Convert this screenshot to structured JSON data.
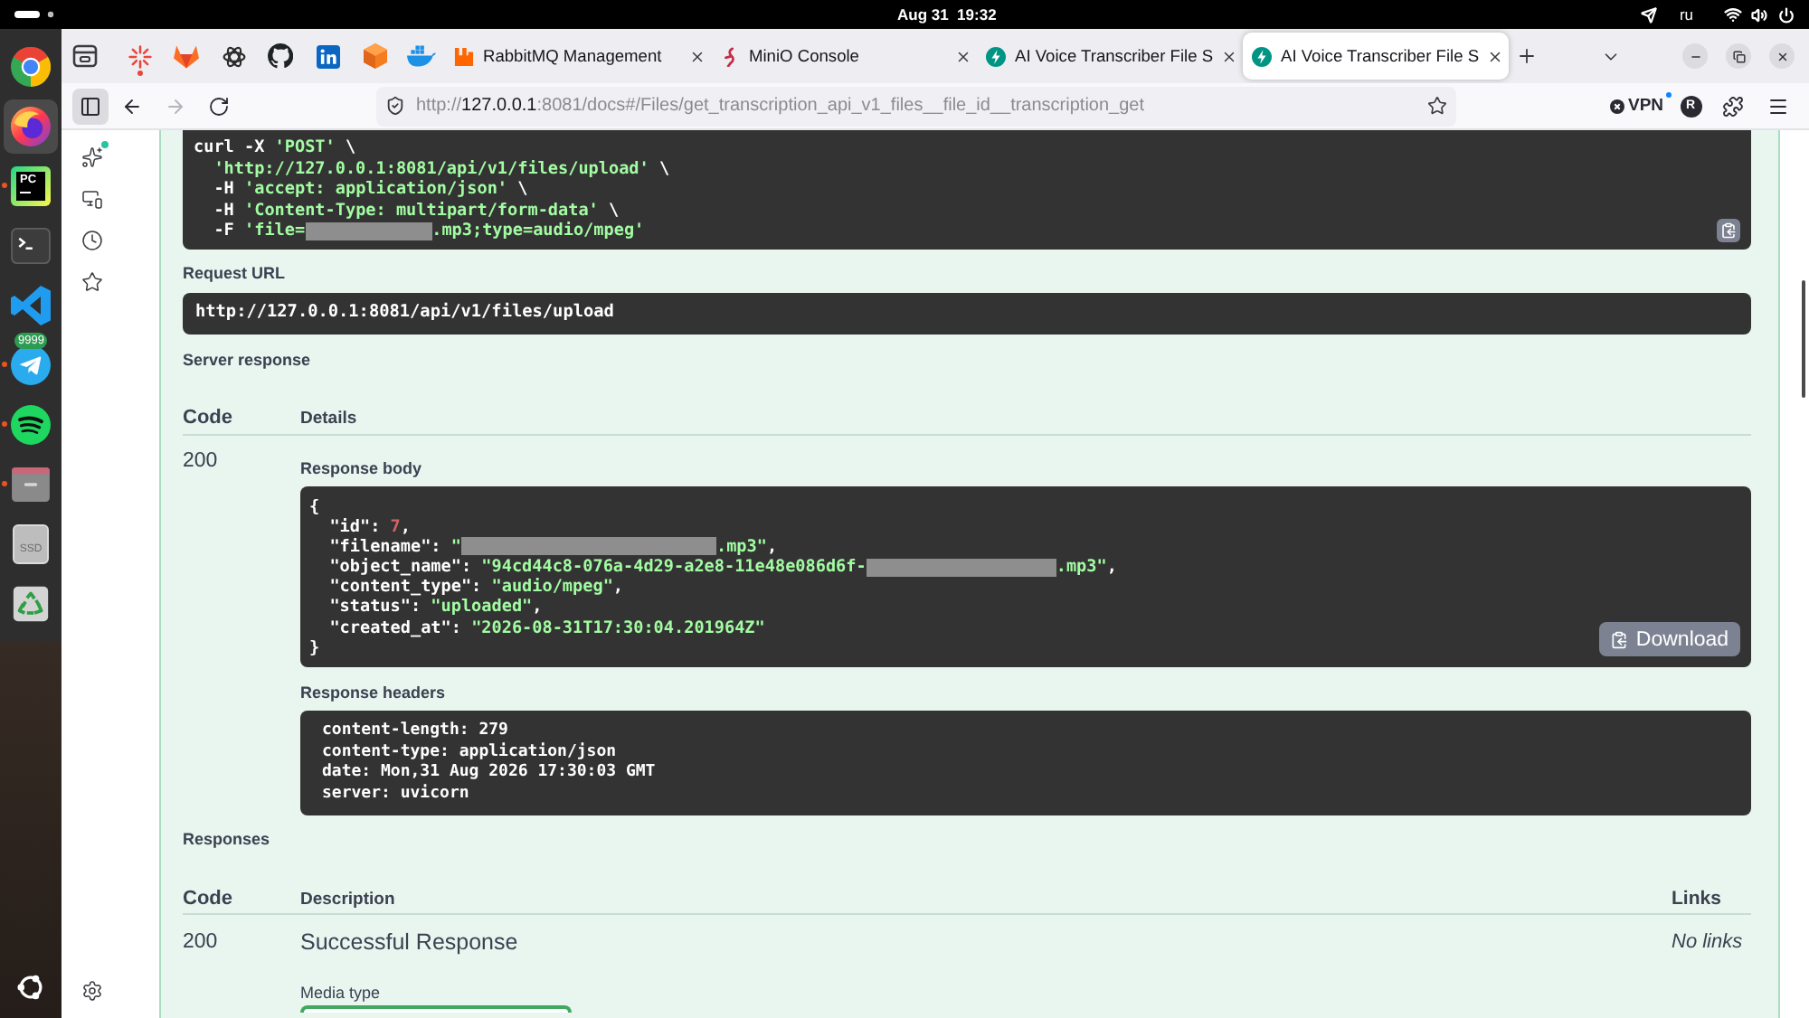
{
  "top_bar": {
    "clock": "Aug 31  19:32",
    "keyboard_layout": "ru"
  },
  "dock": {
    "items": [
      {
        "kind": "tricolor",
        "running": false,
        "focused": false
      },
      {
        "kind": "globe",
        "running": false,
        "focused": true
      },
      {
        "kind": "ide",
        "label": "PC",
        "running": true,
        "focused": false
      },
      {
        "kind": "terminal",
        "running": false,
        "focused": false
      },
      {
        "kind": "editor",
        "running": false,
        "focused": false
      },
      {
        "kind": "messenger",
        "badge": "9999",
        "running": true,
        "focused": false
      },
      {
        "kind": "music",
        "running": true,
        "focused": false
      },
      {
        "kind": "files",
        "running": true,
        "focused": false
      },
      {
        "kind": "drive",
        "label": "SSD",
        "running": false,
        "focused": false
      },
      {
        "kind": "trash",
        "running": false,
        "focused": false
      }
    ]
  },
  "browser": {
    "pinned_tabs": [
      {
        "kind": "starburst",
        "notify": true
      },
      {
        "kind": "fox",
        "notify": false
      },
      {
        "kind": "knot",
        "notify": false
      },
      {
        "kind": "cat",
        "notify": false
      },
      {
        "kind": "square",
        "notify": false
      },
      {
        "kind": "cube",
        "notify": false
      },
      {
        "kind": "whale",
        "notify": false
      }
    ],
    "tabs": [
      {
        "title": "RabbitMQ Management",
        "selected": false
      },
      {
        "title": "MiniO Console",
        "selected": false
      },
      {
        "title": "AI Voice Transcriber File S",
        "selected": false
      },
      {
        "title": "AI Voice Transcriber File S",
        "selected": true
      }
    ],
    "address": {
      "scheme": "http://",
      "host": "127.0.0.1",
      "path": ":8081/docs#/Files/get_transcription_api_v1_files__file_id__transcription_get"
    },
    "vpn": {
      "label": "VPN"
    },
    "account": {
      "initial": "R"
    },
    "sidebar": {
      "items": [
        {
          "kind": "assistant",
          "notify": true
        },
        {
          "kind": "devices",
          "notify": false
        },
        {
          "kind": "history",
          "notify": false
        },
        {
          "kind": "bookmarks",
          "notify": false
        }
      ]
    }
  },
  "page": {
    "curl": {
      "lines": [
        [
          {
            "kind": "plain",
            "text": "curl -X "
          },
          {
            "kind": "string",
            "text": "'POST'"
          },
          {
            "kind": "plain",
            "text": " \\"
          }
        ],
        [
          {
            "kind": "string",
            "text": "  'http://127.0.0.1:8081/api/v1/files/upload'"
          },
          {
            "kind": "plain",
            "text": " \\"
          }
        ],
        [
          {
            "kind": "plain",
            "text": "  -H "
          },
          {
            "kind": "string",
            "text": "'accept: application/json'"
          },
          {
            "kind": "plain",
            "text": " \\"
          }
        ],
        [
          {
            "kind": "plain",
            "text": "  -H "
          },
          {
            "kind": "string",
            "text": "'Content-Type: multipart/form-data'"
          },
          {
            "kind": "plain",
            "text": " \\"
          }
        ],
        [
          {
            "kind": "plain",
            "text": "  -F "
          },
          {
            "kind": "string",
            "text": "'file="
          },
          {
            "kind": "redacted"
          },
          {
            "kind": "string",
            "text": ".mp3;type=audio/mpeg'"
          }
        ]
      ]
    },
    "request_url_label": "Request URL",
    "request_url": "http://127.0.0.1:8081/api/v1/files/upload",
    "server_response_label": "Server response",
    "server_table": {
      "columns": [
        "Code",
        "Details"
      ],
      "rows": [
        {
          "code": "200",
          "body_label": "Response body",
          "body_lines": [
            [
              {
                "kind": "plain",
                "text": "{"
              }
            ],
            [
              {
                "kind": "plain",
                "text": "  \"id\": "
              },
              {
                "kind": "number",
                "text": "7"
              },
              {
                "kind": "plain",
                "text": ","
              }
            ],
            [
              {
                "kind": "plain",
                "text": "  \"filename\": "
              },
              {
                "kind": "string",
                "text": "\""
              },
              {
                "kind": "redacted"
              },
              {
                "kind": "string",
                "text": ".mp3\""
              },
              {
                "kind": "plain",
                "text": ","
              }
            ],
            [
              {
                "kind": "plain",
                "text": "  \"object_name\": "
              },
              {
                "kind": "string",
                "text": "\"94cd44c8-076a-4d29-a2e8-11e48e086d6f-"
              },
              {
                "kind": "redacted"
              },
              {
                "kind": "string",
                "text": ".mp3\""
              },
              {
                "kind": "plain",
                "text": ","
              }
            ],
            [
              {
                "kind": "plain",
                "text": "  \"content_type\": "
              },
              {
                "kind": "string",
                "text": "\"audio/mpeg\""
              },
              {
                "kind": "plain",
                "text": ","
              }
            ],
            [
              {
                "kind": "plain",
                "text": "  \"status\": "
              },
              {
                "kind": "string",
                "text": "\"uploaded\""
              },
              {
                "kind": "plain",
                "text": ","
              }
            ],
            [
              {
                "kind": "plain",
                "text": "  \"created_at\": "
              },
              {
                "kind": "string",
                "text": "\"2026-08-31T17:30:04.201964Z\""
              }
            ],
            [
              {
                "kind": "plain",
                "text": "}"
              }
            ]
          ],
          "download_label": "Download",
          "headers_label": "Response headers",
          "header_lines": [
            "content-length: 279",
            "content-type: application/json",
            "date: Mon,31 Aug 2026 17:30:03 GMT",
            "server: uvicorn"
          ]
        }
      ]
    },
    "responses_label": "Responses",
    "responses_table": {
      "columns": [
        "Code",
        "Description",
        "Links"
      ],
      "rows": [
        {
          "code": "200",
          "description": "Successful Response",
          "links": "No links",
          "media_type_label": "Media type"
        }
      ]
    }
  }
}
